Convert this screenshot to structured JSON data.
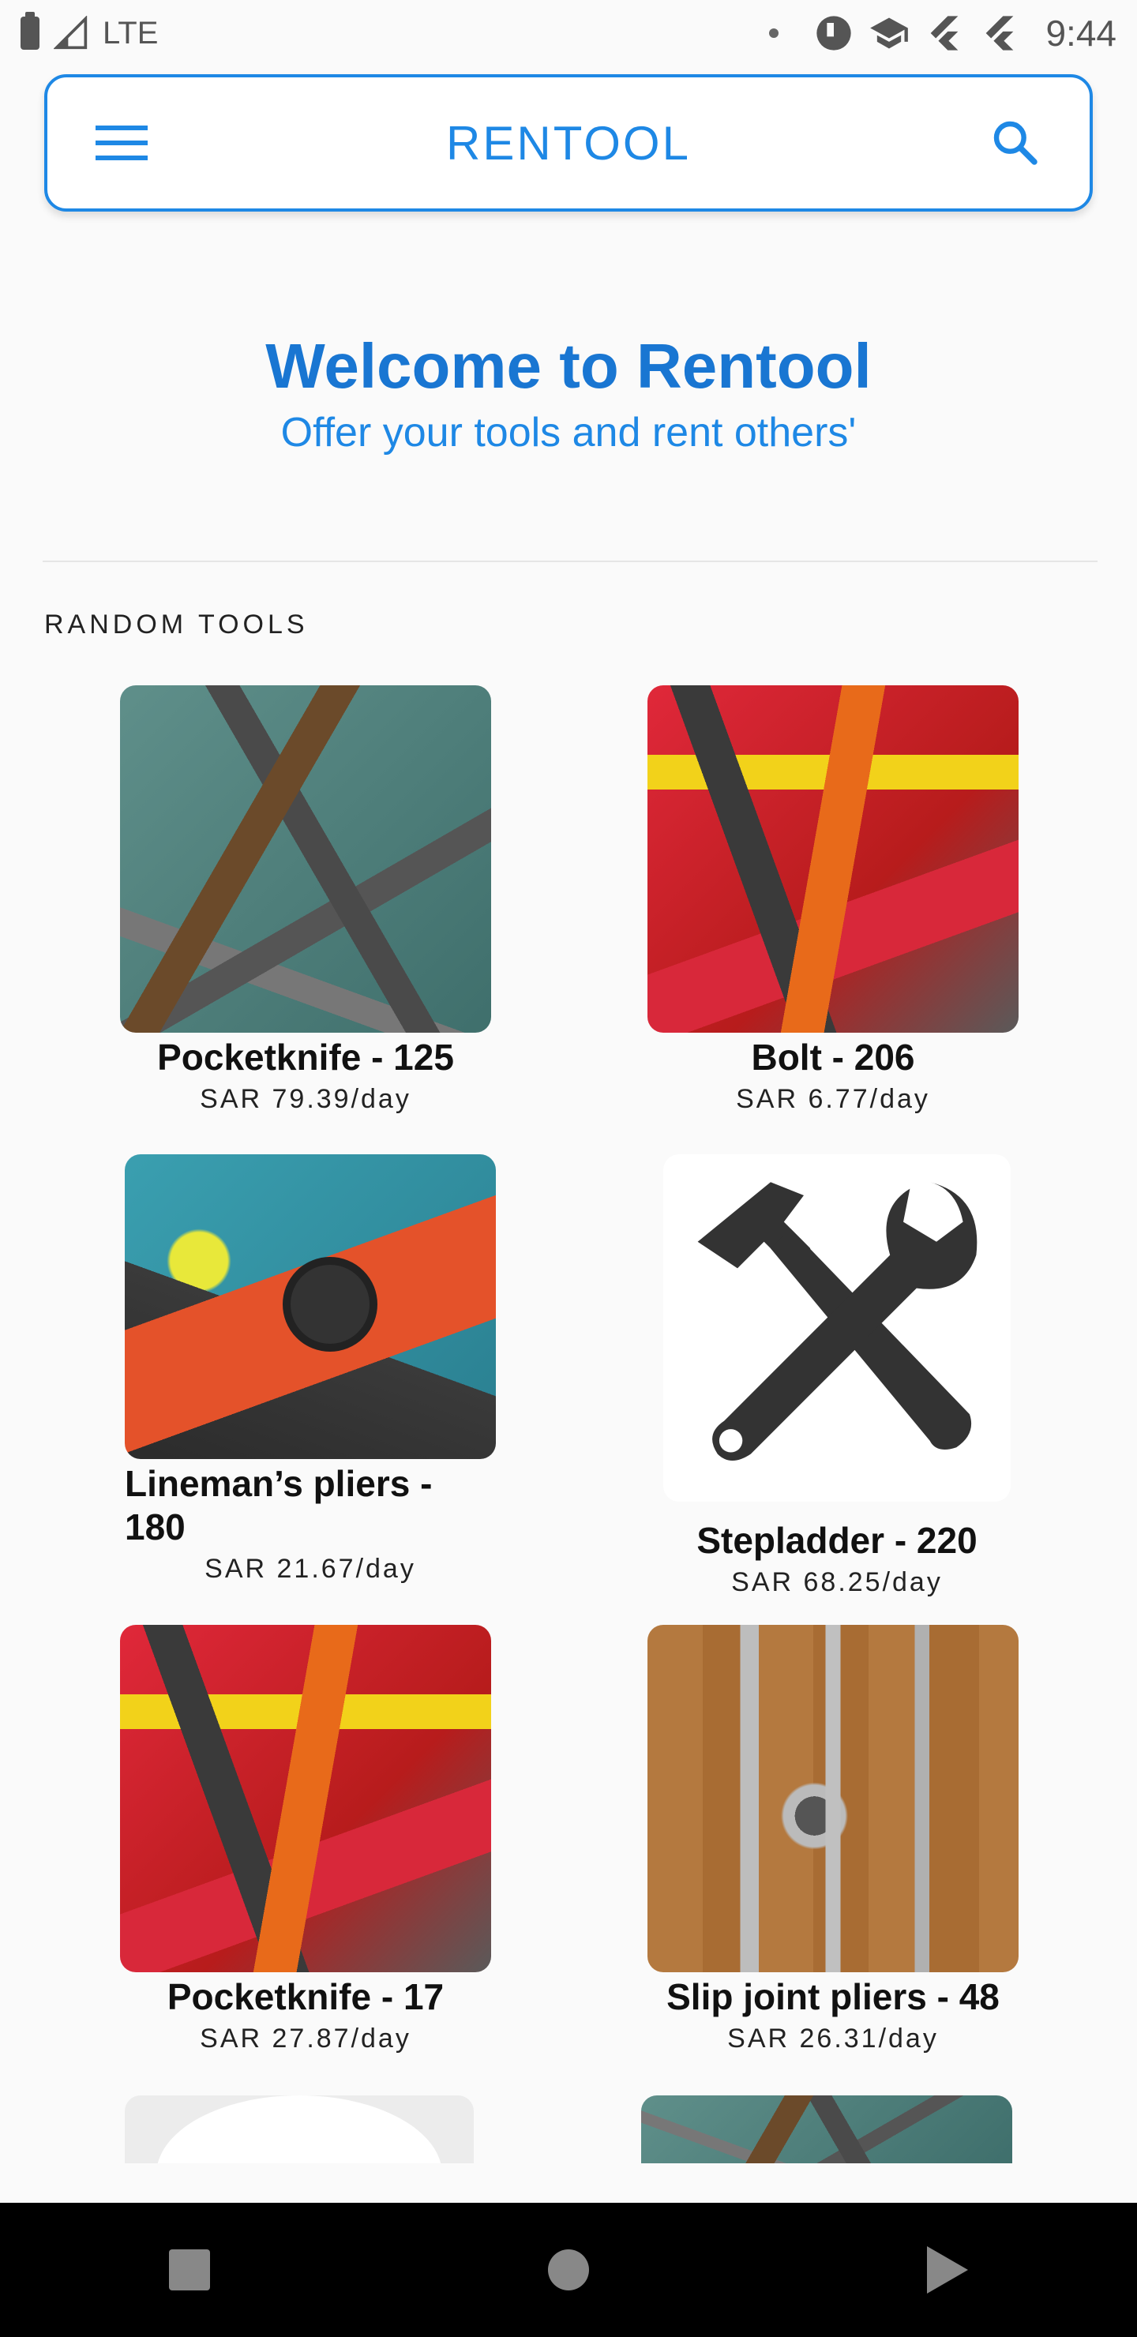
{
  "status_bar": {
    "network": "LTE",
    "time": "9:44"
  },
  "app_bar": {
    "title": "RENTOOL"
  },
  "welcome": {
    "title": "Welcome to Rentool",
    "subtitle": "Offer your tools and rent others'"
  },
  "section": {
    "label": "RANDOM TOOLS"
  },
  "tools": [
    {
      "name": "Pocketknife - 125",
      "price": "SAR 79.39/day"
    },
    {
      "name": "Bolt - 206",
      "price": "SAR 6.77/day"
    },
    {
      "name": "Lineman’s pliers - 180",
      "price": "SAR 21.67/day"
    },
    {
      "name": "Stepladder - 220",
      "price": "SAR 68.25/day"
    },
    {
      "name": "Pocketknife - 17",
      "price": "SAR 27.87/day"
    },
    {
      "name": "Slip joint pliers - 48",
      "price": "SAR 26.31/day"
    }
  ],
  "colors": {
    "accent": "#1e88e5",
    "title": "#1976d2",
    "background": "#fafafa"
  },
  "icons": {
    "menu": "menu-icon",
    "search": "search-icon",
    "tool_placeholder": "hammer-wrench-icon"
  }
}
